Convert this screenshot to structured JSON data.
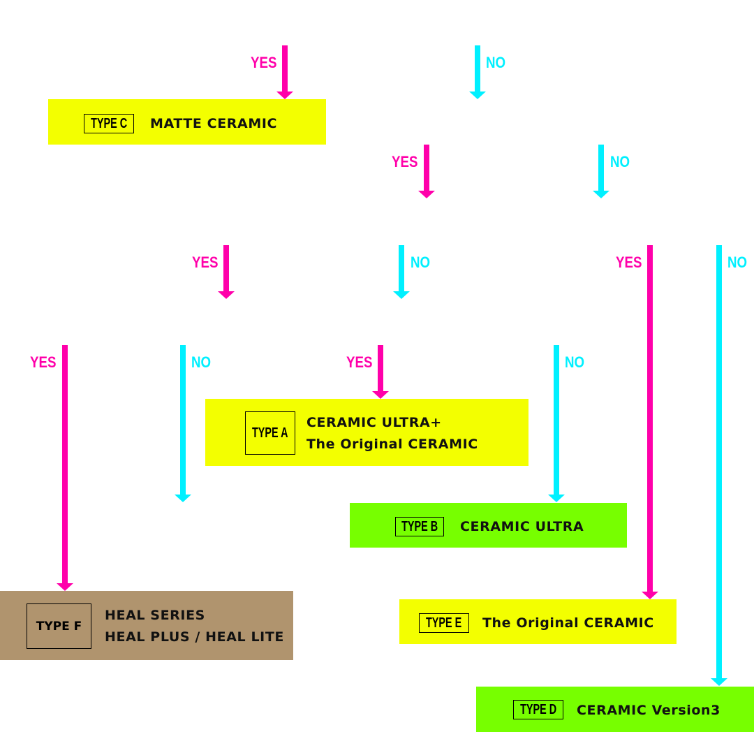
{
  "labels": {
    "yes": "YES",
    "no": "NO"
  },
  "colors": {
    "yes": "#ff00aa",
    "no": "#00f0ff",
    "yellow": "#f3ff00",
    "green": "#77ff00",
    "brown": "#b0946e"
  },
  "results": {
    "type_c": {
      "badge": "TYPE C",
      "lines": [
        "MATTE CERAMIC"
      ]
    },
    "type_a": {
      "badge": "TYPE A",
      "lines": [
        "CERAMIC ULTRA+",
        "The Original CERAMIC"
      ]
    },
    "type_b": {
      "badge": "TYPE B",
      "lines": [
        "CERAMIC ULTRA"
      ]
    },
    "type_f": {
      "badge": "TYPE F",
      "lines": [
        "HEAL SERIES",
        "HEAL PLUS / HEAL LITE"
      ]
    },
    "type_e": {
      "badge": "TYPE E",
      "lines": [
        "The Original CERAMIC"
      ]
    },
    "type_d": {
      "badge": "TYPE D",
      "lines": [
        "CERAMIC Version3"
      ]
    }
  }
}
